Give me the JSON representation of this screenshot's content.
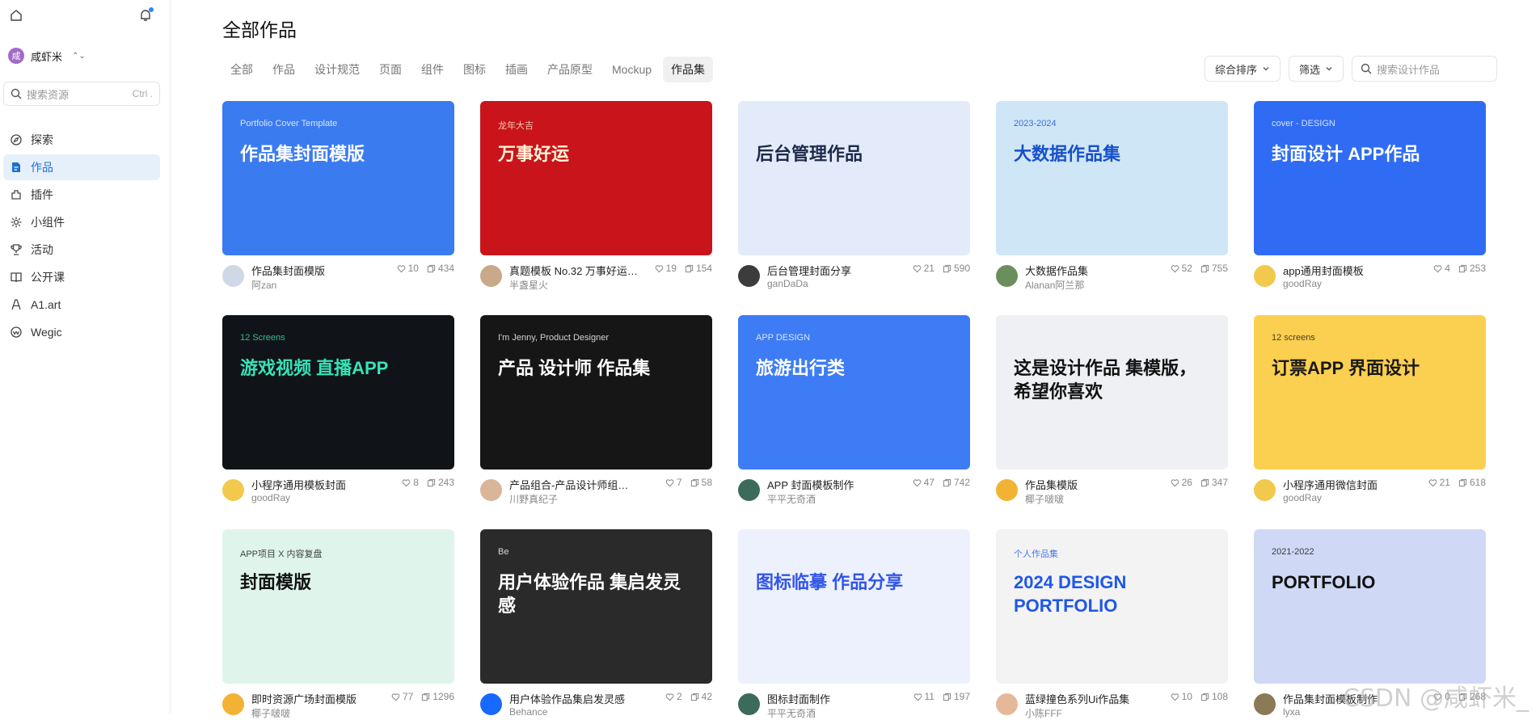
{
  "sidebar": {
    "user": {
      "avatar_char": "咸",
      "name": "咸虾米"
    },
    "search": {
      "placeholder": "搜索资源",
      "shortcut": "Ctrl ."
    },
    "items": [
      {
        "label": "探索",
        "icon": "compass-icon",
        "active": false
      },
      {
        "label": "作品",
        "icon": "document-icon",
        "active": true
      },
      {
        "label": "插件",
        "icon": "plugin-icon",
        "active": false
      },
      {
        "label": "小组件",
        "icon": "widget-icon",
        "active": false
      },
      {
        "label": "活动",
        "icon": "trophy-icon",
        "active": false
      },
      {
        "label": "公开课",
        "icon": "book-icon",
        "active": false
      },
      {
        "label": "A1.art",
        "icon": "ai-icon",
        "active": false
      },
      {
        "label": "Wegic",
        "icon": "wegic-icon",
        "active": false
      }
    ]
  },
  "main": {
    "title": "全部作品",
    "tabs": [
      "全部",
      "作品",
      "设计规范",
      "页面",
      "组件",
      "图标",
      "插画",
      "产品原型",
      "Mockup",
      "作品集"
    ],
    "active_tab": "作品集",
    "sort_label": "综合排序",
    "filter_label": "筛选",
    "search_placeholder": "搜索设计作品"
  },
  "cards": [
    {
      "title": "作品集封面模版",
      "author": "阿zan",
      "likes": "10",
      "views": "434",
      "thumb_text": "作品集封面模版",
      "thumb_sub": "Portfolio Cover Template",
      "bg": "#3a7bf0",
      "fg": "#ffffff",
      "avatar_color": "#cfd8e6"
    },
    {
      "title": "真题模板 No.32 万事好运…",
      "author": "半盏星火",
      "likes": "19",
      "views": "154",
      "thumb_text": "万事好运",
      "thumb_sub": "龙年大吉",
      "bg": "#c9141b",
      "fg": "#fff4d6",
      "avatar_color": "#c9a98a"
    },
    {
      "title": "后台管理封面分享",
      "author": "ganDaDa",
      "likes": "21",
      "views": "590",
      "thumb_text": "后台管理作品",
      "thumb_sub": "",
      "bg": "#e3ebfb",
      "fg": "#1d2a4a",
      "avatar_color": "#3c3c3c"
    },
    {
      "title": "大数据作品集",
      "author": "Alanan阿兰那",
      "likes": "52",
      "views": "755",
      "thumb_text": "大数据作品集",
      "thumb_sub": "2023-2024",
      "bg": "#cfe6f7",
      "fg": "#1750c9",
      "avatar_color": "#6b8e5e"
    },
    {
      "title": "app通用封面模板",
      "author": "goodRay",
      "likes": "4",
      "views": "253",
      "thumb_text": "封面设计 APP作品",
      "thumb_sub": "cover - DESIGN",
      "bg": "#2f6cf3",
      "fg": "#ffffff",
      "avatar_color": "#f2c94c"
    },
    {
      "title": "小程序通用模板封面",
      "author": "goodRay",
      "likes": "8",
      "views": "243",
      "thumb_text": "游戏视频 直播APP",
      "thumb_sub": "12 Screens",
      "bg": "#101418",
      "fg": "#38e3b8",
      "avatar_color": "#f2c94c"
    },
    {
      "title": "产品组合-产品设计师组合网站",
      "author": "川野真纪子",
      "likes": "7",
      "views": "58",
      "thumb_text": "产品 设计师 作品集",
      "thumb_sub": "I'm Jenny, Product Designer",
      "bg": "#161616",
      "fg": "#ffffff",
      "avatar_color": "#d9b59a"
    },
    {
      "title": "APP 封面模板制作",
      "author": "平平无奇酒",
      "likes": "47",
      "views": "742",
      "thumb_text": "旅游出行类",
      "thumb_sub": "APP DESIGN",
      "bg": "#3d7cf4",
      "fg": "#ffffff",
      "avatar_color": "#3c6b5b"
    },
    {
      "title": "作品集模版",
      "author": "椰子啵啵",
      "likes": "26",
      "views": "347",
      "thumb_text": "这是设计作品 集模版，希望你喜欢",
      "thumb_sub": "",
      "bg": "#eef0f3",
      "fg": "#111111",
      "avatar_color": "#f2b233"
    },
    {
      "title": "小程序通用微信封面",
      "author": "goodRay",
      "likes": "21",
      "views": "618",
      "thumb_text": "订票APP 界面设计",
      "thumb_sub": "12 screens",
      "bg": "#fbcf4f",
      "fg": "#1a1a1a",
      "avatar_color": "#f2c94c"
    },
    {
      "title": "即时资源广场封面模版",
      "author": "椰子啵啵",
      "likes": "77",
      "views": "1296",
      "thumb_text": "封面模版",
      "thumb_sub": "APP项目 X 内容复盘",
      "bg": "#dff5ec",
      "fg": "#111111",
      "avatar_color": "#f2b233"
    },
    {
      "title": "用户体验作品集启发灵感",
      "author": "Behance",
      "likes": "2",
      "views": "42",
      "thumb_text": "用户体验作品 集启发灵感",
      "thumb_sub": "Be",
      "bg": "#2a2a2a",
      "fg": "#ffffff",
      "avatar_color": "#1769ff"
    },
    {
      "title": "图标封面制作",
      "author": "平平无奇酒",
      "likes": "11",
      "views": "197",
      "thumb_text": "图标临摹 作品分享",
      "thumb_sub": "",
      "bg": "#edf1fd",
      "fg": "#3155e8",
      "avatar_color": "#3c6b5b"
    },
    {
      "title": "蓝绿撞色系列Ui作品集",
      "author": "小陈FFF",
      "likes": "10",
      "views": "108",
      "thumb_text": "2024 DESIGN PORTFOLIO",
      "thumb_sub": "个人作品集",
      "bg": "#f3f3f3",
      "fg": "#1f57e8",
      "avatar_color": "#e6b89a"
    },
    {
      "title": "作品集封面模板制作",
      "author": "lyxa",
      "likes": "0",
      "views": "268",
      "thumb_text": "PORTFOLIO",
      "thumb_sub": "2021-2022",
      "bg": "#cfd9f5",
      "fg": "#111111",
      "avatar_color": "#8a7a55"
    }
  ],
  "watermark": "CSDN @咸虾米_"
}
